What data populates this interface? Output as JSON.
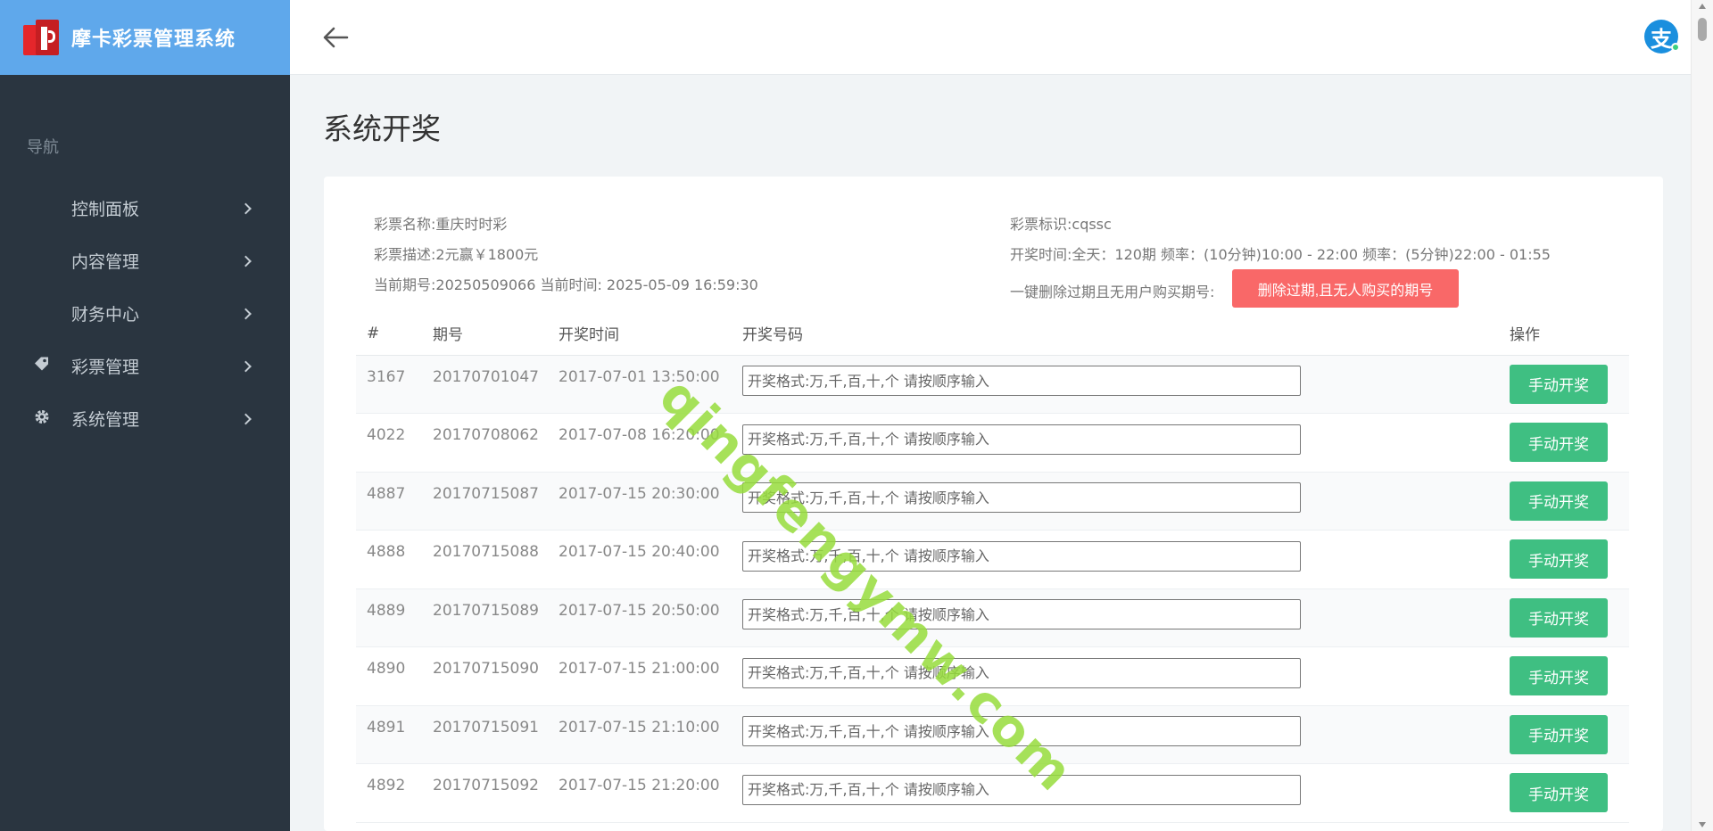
{
  "brand": {
    "title": "摩卡彩票管理系统"
  },
  "sidebar": {
    "header": "导航",
    "items": [
      {
        "label": "控制面板",
        "icon": ""
      },
      {
        "label": "内容管理",
        "icon": ""
      },
      {
        "label": "财务中心",
        "icon": ""
      },
      {
        "label": "彩票管理",
        "icon": "tag-icon"
      },
      {
        "label": "系统管理",
        "icon": "gear-icon"
      }
    ]
  },
  "topbar": {
    "avatar_char": "支"
  },
  "page": {
    "title": "系统开奖"
  },
  "lottery": {
    "name": "彩票名称:重庆时时彩",
    "desc": "彩票描述:2元赢￥1800元",
    "current": "当前期号:20250509066 当前时间: 2025-05-09 16:59:30",
    "id": "彩票标识:cqssc",
    "schedule": "开奖时间:全天：120期 频率：(10分钟)10:00 - 22:00 频率：(5分钟)22:00 - 01:55",
    "delete_hint": "一键删除过期且无用户购买期号:",
    "delete_button": "删除过期,且无人购买的期号"
  },
  "table": {
    "headers": {
      "id": "#",
      "issue": "期号",
      "time": "开奖时间",
      "code": "开奖号码",
      "op": "操作"
    },
    "input_placeholder": "开奖格式:万,千,百,十,个 请按顺序输入",
    "button_label": "手动开奖",
    "rows": [
      {
        "id": "3167",
        "issue": "20170701047",
        "time": "2017-07-01 13:50:00"
      },
      {
        "id": "4022",
        "issue": "20170708062",
        "time": "2017-07-08 16:20:00"
      },
      {
        "id": "4887",
        "issue": "20170715087",
        "time": "2017-07-15 20:30:00"
      },
      {
        "id": "4888",
        "issue": "20170715088",
        "time": "2017-07-15 20:40:00"
      },
      {
        "id": "4889",
        "issue": "20170715089",
        "time": "2017-07-15 20:50:00"
      },
      {
        "id": "4890",
        "issue": "20170715090",
        "time": "2017-07-15 21:00:00"
      },
      {
        "id": "4891",
        "issue": "20170715091",
        "time": "2017-07-15 21:10:00"
      },
      {
        "id": "4892",
        "issue": "20170715092",
        "time": "2017-07-15 21:20:00"
      }
    ]
  },
  "watermark": "qingfengymw.com",
  "colors": {
    "sidebar": "#2a3540",
    "brand": "#5fa8eb",
    "danger": "#f96868",
    "success": "#3fbf82"
  }
}
